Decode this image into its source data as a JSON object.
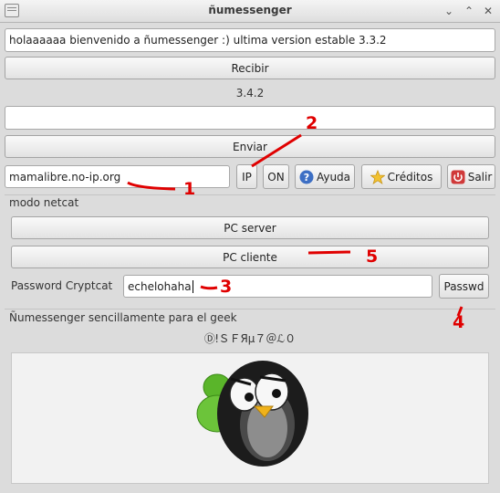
{
  "window": {
    "title": "ñumessenger"
  },
  "main": {
    "welcome_text": "holaaaaaa bienvenido a ñumessenger :) ultima version estable 3.3.2",
    "receive_label": "Recibir",
    "version_text": "3.4.2",
    "message_value": "",
    "send_label": "Enviar",
    "host_value": "mamalibre.no-ip.org",
    "ip_label": "IP",
    "on_label": "ON",
    "help_label": "Ayuda",
    "credits_label": "Créditos",
    "exit_label": "Salir"
  },
  "netcat": {
    "group_title": "modo netcat",
    "pc_server_label": "PC server",
    "pc_client_label": "PC cliente",
    "password_label": "Password Cryptcat",
    "password_value": "echelohaha",
    "passwd_button_label": "Passwd"
  },
  "footer": {
    "group_title": "Ñumessenger sencillamente para el geek",
    "fancy_text": "ⒹǃＳＦЯμ７＠ℒ０"
  },
  "annotations": {
    "n1": "1",
    "n2": "2",
    "n3": "3",
    "n4": "4",
    "n5": "5"
  },
  "colors": {
    "annotation": "#e00000",
    "help_icon": "#3d6fc4",
    "exit_icon": "#d03a3a",
    "star_icon": "#f2c230"
  }
}
